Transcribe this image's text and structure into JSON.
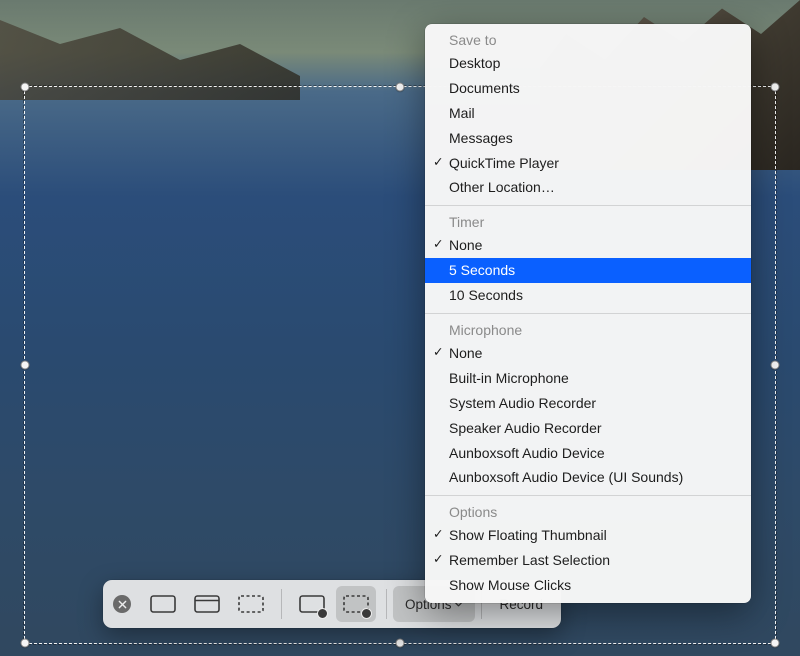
{
  "wallpaper": "catalina-ocean",
  "toolbar": {
    "close_label": "Close",
    "buttons": {
      "capture_entire": "Capture Entire Screen",
      "capture_window": "Capture Selected Window",
      "capture_selection": "Capture Selected Portion",
      "record_entire": "Record Entire Screen",
      "record_selection": "Record Selected Portion"
    },
    "selected_button": "record_selection",
    "options_label": "Options",
    "record_label": "Record"
  },
  "menu": {
    "sections": [
      {
        "header": "Save to",
        "items": [
          {
            "label": "Desktop",
            "checked": false
          },
          {
            "label": "Documents",
            "checked": false
          },
          {
            "label": "Mail",
            "checked": false
          },
          {
            "label": "Messages",
            "checked": false
          },
          {
            "label": "QuickTime Player",
            "checked": true
          },
          {
            "label": "Other Location…",
            "checked": false
          }
        ]
      },
      {
        "header": "Timer",
        "items": [
          {
            "label": "None",
            "checked": true
          },
          {
            "label": "5 Seconds",
            "checked": false,
            "highlighted": true
          },
          {
            "label": "10 Seconds",
            "checked": false
          }
        ]
      },
      {
        "header": "Microphone",
        "items": [
          {
            "label": "None",
            "checked": true
          },
          {
            "label": "Built-in Microphone",
            "checked": false
          },
          {
            "label": "System Audio Recorder",
            "checked": false
          },
          {
            "label": "Speaker Audio Recorder",
            "checked": false
          },
          {
            "label": "Aunboxsoft Audio Device",
            "checked": false
          },
          {
            "label": "Aunboxsoft Audio Device (UI Sounds)",
            "checked": false
          }
        ]
      },
      {
        "header": "Options",
        "items": [
          {
            "label": "Show Floating Thumbnail",
            "checked": true
          },
          {
            "label": "Remember Last Selection",
            "checked": true
          },
          {
            "label": "Show Mouse Clicks",
            "checked": false
          }
        ]
      }
    ]
  }
}
